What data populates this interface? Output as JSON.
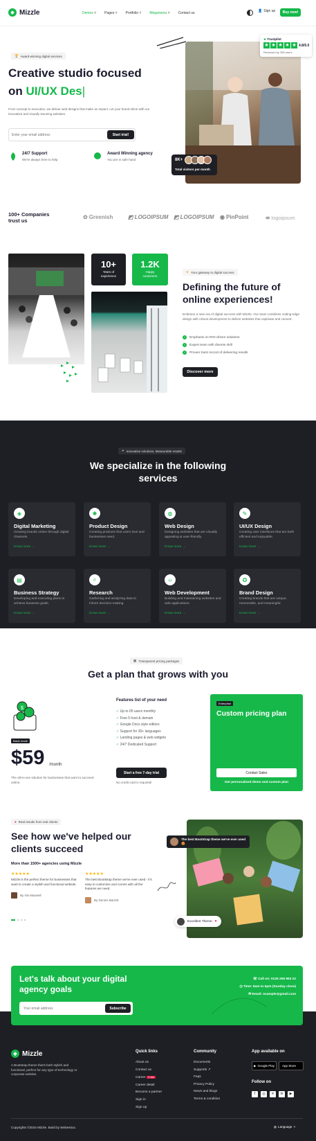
{
  "brand": {
    "name": "Mizzle",
    "accent": "#16b84a",
    "dark": "#1e1f24"
  },
  "nav": {
    "links": [
      "Demos",
      "Pages",
      "Portfolio",
      "Megamenu",
      "Contact us"
    ],
    "sign_up": "Sign up",
    "buy": "Buy now!"
  },
  "hero": {
    "badge": "Award-winning digital services",
    "title_line1": "Creative studio focused",
    "title_line2_prefix": "on ",
    "title_line2_typed": "UI/UX Des",
    "desc": "From concept to execution, we deliver web designs that make an impact. Let your brand shine with our innovative and visually stunning websites.",
    "email_placeholder": "Enter your email address",
    "cta": "Start trial!",
    "support_title": "24/7 Support",
    "support_desc": "We're always here to help",
    "award_title": "Award Winning agency",
    "award_desc": "You are in safe hand",
    "trustpilot_label": "Trustpilot",
    "trustpilot_rating": "4.8/5.0",
    "trustpilot_reviews": "Reviewed by 265 users",
    "visitors_count": "8K+",
    "visitors_label": "Total visitors per month"
  },
  "clients": {
    "label": "100+ Companies trust us",
    "logos": [
      "Greenish",
      "LOGOIPSUM",
      "LOGOIPSUM",
      "PinPoint",
      "logoipsum"
    ]
  },
  "about": {
    "stat1_value": "10+",
    "stat1_label": "Years of experience",
    "stat2_value": "1.2K",
    "stat2_label": "Happy customers",
    "badge": "Your gateway to digital success",
    "title": "Defining the future of online experiences!",
    "desc": "Embrace a new era of digital success with Mizzle. Our team combines cutting-edge design with robust development to deliver websites that captivate and convert.",
    "points": [
      "Emphasis on ROI-driven solutions",
      "Expert team with diverse skill",
      "Proven track record of delivering results"
    ],
    "cta": "Discover more"
  },
  "services": {
    "badge": "Innovative solutions, Measurable results",
    "title_line1": "We specialize in the following",
    "title_line2": "services",
    "more": "Know more",
    "items": [
      {
        "title": "Digital Marketing",
        "desc": "Growing brands online through digital channels.",
        "icon": "megaphone-icon"
      },
      {
        "title": "Product Design",
        "desc": "Creating products that users love and businesses need.",
        "icon": "bulb-icon"
      },
      {
        "title": "Web Design",
        "desc": "Designing websites that are visually appealing & user-friendly.",
        "icon": "globe-icon"
      },
      {
        "title": "UI/UX Design",
        "desc": "Creating user interfaces that are both efficient and enjoyable.",
        "icon": "pen-icon"
      },
      {
        "title": "Business Strategy",
        "desc": "Developing and executing plans to achieve business goals.",
        "icon": "chart-icon"
      },
      {
        "title": "Research",
        "desc": "Gathering and analyzing data to inform decision-making.",
        "icon": "search-icon"
      },
      {
        "title": "Web Development",
        "desc": "Building and maintaining websites and web applications.",
        "icon": "code-icon"
      },
      {
        "title": "Brand Design",
        "desc": "Creating brands that are unique, memorable, and meaningful.",
        "icon": "star-icon"
      }
    ]
  },
  "pricing": {
    "badge": "Transparent pricing packages",
    "title": "Get a plan that grows with you",
    "plan_tag": "Basic mode",
    "price": "$59",
    "period": "/month",
    "plan_desc": "The all-in-one solution for businesses that want to succeed online.",
    "features_title": "Features list of your need",
    "features": [
      "Up to 05 users monthly",
      "Free 5 host & domain",
      "Google Docs style editors",
      "Support for 30+ languages",
      "Landing pages & web widgets",
      "24/7 Dedicated Support"
    ],
    "trial_cta": "Start a free 7-day trial",
    "no_card": "No credit card is required!",
    "ent_tag": "Enterprise",
    "ent_title": "Custom pricing plan",
    "ent_cta": "Contact Sales",
    "ent_note": "Get personalized demo and custom plan"
  },
  "testimonials": {
    "badge": "Real results from real clients",
    "title_line1": "See how we've helped our",
    "title_line2": "clients succeed",
    "subtitle": "More than 1500+ agencies using Mizzle",
    "stars": "★★★★★",
    "items": [
      {
        "text": "Mizzle is the perfect theme for businesses that want to create a stylish and functional website.",
        "author": "By Nix Maxwell"
      },
      {
        "text": "The best Bootstrap theme we've ever used - it's easy to customize and comes with all the features we need.",
        "author": "By Dennis Barrett"
      }
    ],
    "bubble": "The best Bootstrap theme we've ever used",
    "bubble_emoji": "😍",
    "pill": "Excellent Theme"
  },
  "cta": {
    "title_line1": "Let's talk about your digital",
    "title_line2": "agency goals",
    "email_placeholder": "Your email address",
    "subscribe": "Subscribe",
    "call": "Call on: 0125 258 963 22",
    "time": "Time: 9am to 5pm (Sunday close)",
    "email": "Email: example@gmail.com"
  },
  "footer": {
    "desc": "A Bootstrap theme that's both stylish and functional, perfect for any type of technology or corporate website.",
    "quick_title": "Quick links",
    "quick": [
      "About us",
      "Contact us",
      "Career",
      "Career detail",
      "Become a partner",
      "Sign in",
      "Sign up"
    ],
    "career_badge": "2 Job",
    "community_title": "Community",
    "community": [
      "Documents",
      "Supports",
      "Faqs",
      "Privacy Policy",
      "News and blogs",
      "Terms & condition"
    ],
    "app_title": "App available on",
    "google": "Google Play",
    "apple": "App Store",
    "follow": "Follow on",
    "copyright": "Copyrights ©2024 Mizzle. Build by Webestica.",
    "language": "Language"
  }
}
